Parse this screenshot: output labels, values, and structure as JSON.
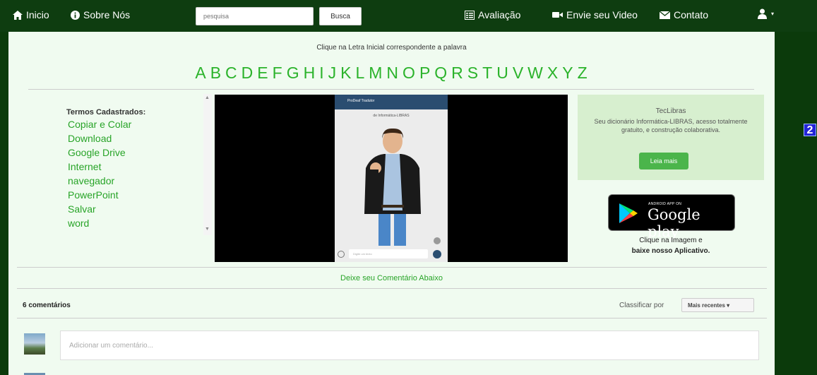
{
  "navbar": {
    "inicio": "Inicio",
    "sobre": "Sobre Nós",
    "search_placeholder": "pesquisa",
    "search_button": "Busca",
    "avaliacao": "Avaliação",
    "envie_video": "Envie seu Video",
    "contato": "Contato"
  },
  "instruction": "Clique na Letra Inicial correspondente a palavra",
  "letters": [
    "A",
    "B",
    "C",
    "D",
    "E",
    "F",
    "G",
    "H",
    "I",
    "J",
    "K",
    "L",
    "M",
    "N",
    "O",
    "P",
    "Q",
    "R",
    "S",
    "T",
    "U",
    "V",
    "W",
    "X",
    "Y",
    "Z"
  ],
  "terms": {
    "title": "Termos Cadastrados:",
    "items": [
      "Copiar e Colar",
      "Download",
      "Google Drive",
      "Internet",
      "navegador",
      "PowerPoint",
      "Salvar",
      "word"
    ]
  },
  "video": {
    "app_bar": "ProDeaf Tradutor",
    "subtitle": "de Informática-LIBRAS",
    "input_placeholder": "Digite um texto"
  },
  "tec": {
    "title": "TecLibras",
    "description": "Seu dicionário Informática-LIBRAS, acesso totalmente gratuito, e construção colaborativa.",
    "button": "Leia mais"
  },
  "gplay": {
    "small": "ANDROID APP ON",
    "big": "Google play",
    "caption_line1": "Clique na Imagem e",
    "caption_line2": "baixe nosso Aplicativo."
  },
  "comment_link": "Deixe seu Comentário Abaixo",
  "comments": {
    "count": "6 comentários",
    "sort_label": "Classificar por",
    "sort_value": "Mais recentes ▾",
    "placeholder": "Adicionar um comentário..."
  },
  "badge": "2"
}
